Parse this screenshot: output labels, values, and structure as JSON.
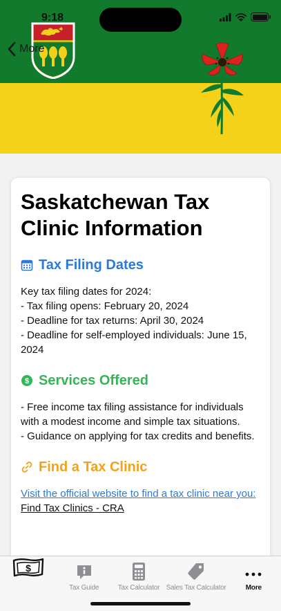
{
  "status_bar": {
    "time": "9:18"
  },
  "nav": {
    "back_label": "More"
  },
  "card": {
    "title": "Saskatchewan Tax Clinic Information",
    "sections": [
      {
        "heading": "Tax Filing Dates",
        "icon": "calendar-icon",
        "color": "#2a7ad6",
        "body": "Key tax filing dates for 2024:\n- Tax filing opens: February 20, 2024\n- Deadline for tax returns: April 30, 2024\n- Deadline for self-employed individuals: June 15, 2024"
      },
      {
        "heading": "Services Offered",
        "icon": "dollar-circle-icon",
        "color": "#34b558",
        "body": "- Free income tax filing assistance for individuals with a modest income and simple tax situations.\n- Guidance on applying for tax credits and benefits."
      },
      {
        "heading": "Find a Tax Clinic",
        "icon": "link-icon",
        "color": "#f0a21b",
        "link_text": "Visit the official website to find a tax clinic near you:",
        "link_name": "Find Tax Clinics - CRA"
      }
    ]
  },
  "tabbar": {
    "tabs": [
      {
        "label": "",
        "icon": "dollar-bill-icon",
        "active": false
      },
      {
        "label": "Tax Guide",
        "icon": "info-bubble-icon",
        "active": false
      },
      {
        "label": "Tax Calculator",
        "icon": "calculator-icon",
        "active": false
      },
      {
        "label": "Sales Tax Calculator",
        "icon": "price-tag-icon",
        "active": false
      },
      {
        "label": "More",
        "icon": "more-dots-icon",
        "active": true
      }
    ]
  }
}
